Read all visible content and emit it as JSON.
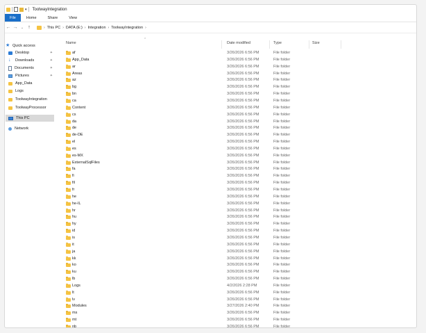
{
  "window": {
    "title": "ToolwayIntegration"
  },
  "ribbon": {
    "tabs": [
      "File",
      "Home",
      "Share",
      "View"
    ]
  },
  "address": {
    "crumbs": [
      "This PC",
      "DATA (E:)",
      "Integration",
      "ToolwayIntegration"
    ]
  },
  "sidebar": {
    "quick_access": "Quick access",
    "items": [
      {
        "label": "Desktop",
        "icon": "desktop-icon",
        "pinned": true
      },
      {
        "label": "Downloads",
        "icon": "download-icon",
        "pinned": true
      },
      {
        "label": "Documents",
        "icon": "documents-icon",
        "pinned": true
      },
      {
        "label": "Pictures",
        "icon": "pictures-icon",
        "pinned": true
      },
      {
        "label": "App_Data",
        "icon": "folder-icon",
        "pinned": false
      },
      {
        "label": "Logs",
        "icon": "folder-icon",
        "pinned": false
      },
      {
        "label": "ToolwayIntegration",
        "icon": "folder-icon",
        "pinned": false
      },
      {
        "label": "ToolwayProcessor",
        "icon": "folder-icon",
        "pinned": false
      }
    ],
    "this_pc": "This PC",
    "network": "Network"
  },
  "columns": {
    "name": "Name",
    "date": "Date modified",
    "type": "Type",
    "size": "Size"
  },
  "files": [
    {
      "name": "af",
      "date": "3/26/2026 6:56 PM",
      "type": "File folder"
    },
    {
      "name": "App_Data",
      "date": "3/26/2026 6:56 PM",
      "type": "File folder"
    },
    {
      "name": "ar",
      "date": "3/26/2026 6:56 PM",
      "type": "File folder"
    },
    {
      "name": "Areas",
      "date": "3/26/2026 6:56 PM",
      "type": "File folder"
    },
    {
      "name": "az",
      "date": "3/26/2026 6:56 PM",
      "type": "File folder"
    },
    {
      "name": "bg",
      "date": "3/26/2026 6:56 PM",
      "type": "File folder"
    },
    {
      "name": "bn",
      "date": "3/26/2026 6:56 PM",
      "type": "File folder"
    },
    {
      "name": "ca",
      "date": "3/26/2026 6:56 PM",
      "type": "File folder"
    },
    {
      "name": "Content",
      "date": "3/26/2026 6:56 PM",
      "type": "File folder"
    },
    {
      "name": "cs",
      "date": "3/26/2026 6:56 PM",
      "type": "File folder"
    },
    {
      "name": "da",
      "date": "3/26/2026 6:56 PM",
      "type": "File folder"
    },
    {
      "name": "de",
      "date": "3/26/2026 6:56 PM",
      "type": "File folder"
    },
    {
      "name": "de-DE",
      "date": "3/26/2026 6:56 PM",
      "type": "File folder"
    },
    {
      "name": "el",
      "date": "3/26/2026 6:56 PM",
      "type": "File folder"
    },
    {
      "name": "es",
      "date": "3/26/2026 6:56 PM",
      "type": "File folder"
    },
    {
      "name": "es-MX",
      "date": "3/26/2026 6:56 PM",
      "type": "File folder"
    },
    {
      "name": "ExternalSqlFiles",
      "date": "3/26/2026 6:56 PM",
      "type": "File folder"
    },
    {
      "name": "fa",
      "date": "3/26/2026 6:56 PM",
      "type": "File folder"
    },
    {
      "name": "fi",
      "date": "3/26/2026 6:56 PM",
      "type": "File folder"
    },
    {
      "name": "fil",
      "date": "3/26/2026 6:56 PM",
      "type": "File folder"
    },
    {
      "name": "fr",
      "date": "3/26/2026 6:56 PM",
      "type": "File folder"
    },
    {
      "name": "he",
      "date": "3/26/2026 6:56 PM",
      "type": "File folder"
    },
    {
      "name": "he-IL",
      "date": "3/26/2026 6:56 PM",
      "type": "File folder"
    },
    {
      "name": "hr",
      "date": "3/26/2026 6:56 PM",
      "type": "File folder"
    },
    {
      "name": "hu",
      "date": "3/26/2026 6:56 PM",
      "type": "File folder"
    },
    {
      "name": "hy",
      "date": "3/26/2026 6:56 PM",
      "type": "File folder"
    },
    {
      "name": "id",
      "date": "3/26/2026 6:56 PM",
      "type": "File folder"
    },
    {
      "name": "is",
      "date": "3/26/2026 6:56 PM",
      "type": "File folder"
    },
    {
      "name": "it",
      "date": "3/26/2026 6:56 PM",
      "type": "File folder"
    },
    {
      "name": "ja",
      "date": "3/26/2026 6:56 PM",
      "type": "File folder"
    },
    {
      "name": "kk",
      "date": "3/26/2026 6:56 PM",
      "type": "File folder"
    },
    {
      "name": "ko",
      "date": "3/26/2026 6:56 PM",
      "type": "File folder"
    },
    {
      "name": "ku",
      "date": "3/26/2026 6:56 PM",
      "type": "File folder"
    },
    {
      "name": "lb",
      "date": "3/26/2026 6:56 PM",
      "type": "File folder"
    },
    {
      "name": "Logs",
      "date": "4/2/2026 2:28 PM",
      "type": "File folder"
    },
    {
      "name": "lt",
      "date": "3/26/2026 6:56 PM",
      "type": "File folder"
    },
    {
      "name": "lv",
      "date": "3/26/2026 6:56 PM",
      "type": "File folder"
    },
    {
      "name": "Modules",
      "date": "3/27/2026 2:40 PM",
      "type": "File folder"
    },
    {
      "name": "ms",
      "date": "3/26/2026 6:56 PM",
      "type": "File folder"
    },
    {
      "name": "mt",
      "date": "3/26/2026 6:56 PM",
      "type": "File folder"
    },
    {
      "name": "nb",
      "date": "3/26/2026 6:56 PM",
      "type": "File folder"
    }
  ]
}
